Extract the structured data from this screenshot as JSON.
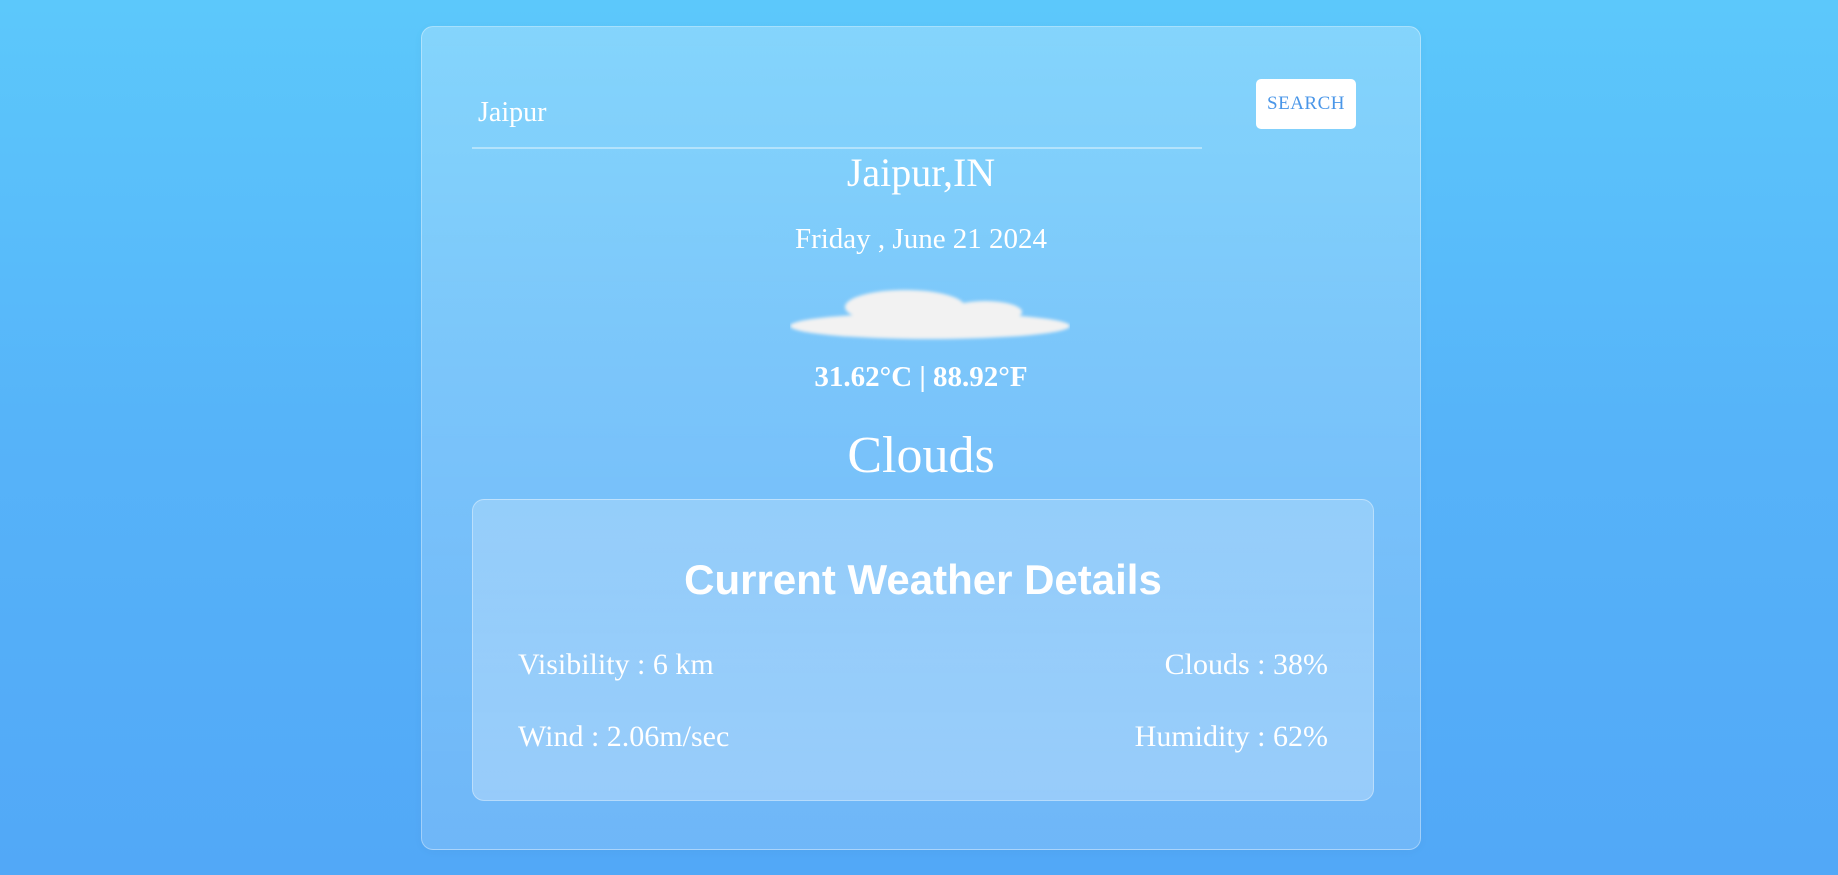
{
  "search": {
    "value": "Jaipur",
    "button_label": "SEARCH"
  },
  "weather": {
    "location": "Jaipur,IN",
    "date": "Friday , June 21 2024",
    "icon": "cloud-icon",
    "temperature": "31.62°C | 88.92°F",
    "condition": "Clouds"
  },
  "details": {
    "title": "Current Weather Details",
    "visibility": "Visibility : 6 km",
    "clouds": "Clouds : 38%",
    "wind": "Wind : 2.06m/sec",
    "humidity": "Humidity : 62%"
  },
  "colors": {
    "background_top": "#5cc8fb",
    "background_bottom": "#52a8f7",
    "button_text": "#4a96e8",
    "text": "#ffffff"
  }
}
